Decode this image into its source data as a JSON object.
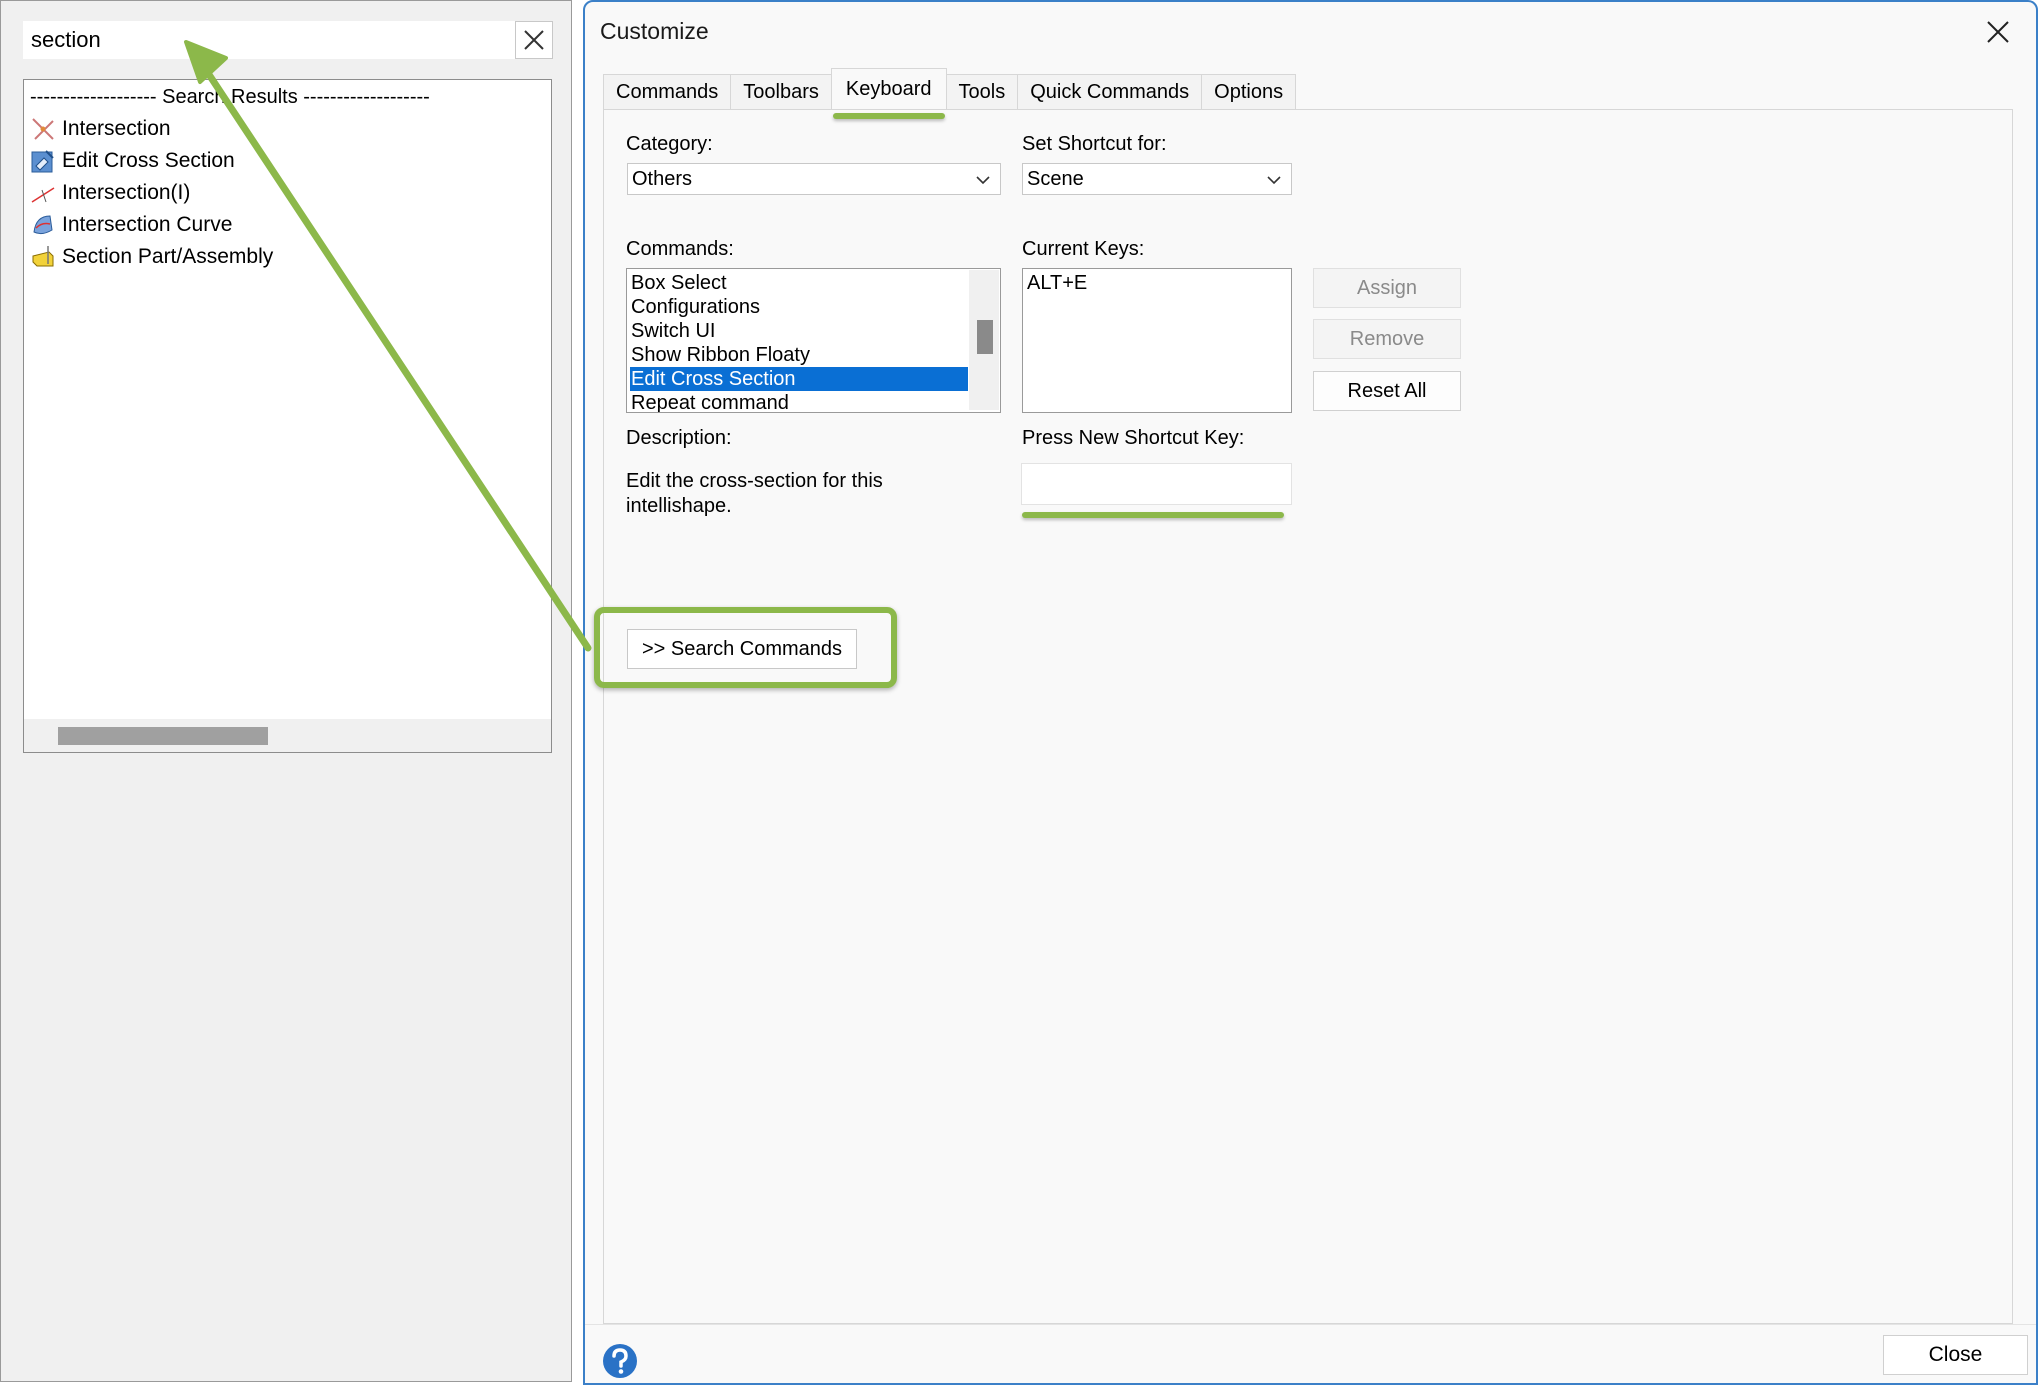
{
  "search_panel": {
    "query": "section",
    "results_header": "------------------- Search Results -------------------",
    "results": [
      {
        "label": "Intersection",
        "icon": "intersection-icon"
      },
      {
        "label": "Edit Cross Section",
        "icon": "edit-cross-section-icon"
      },
      {
        "label": "Intersection(I)",
        "icon": "intersection-line-icon"
      },
      {
        "label": "Intersection Curve",
        "icon": "intersection-curve-icon"
      },
      {
        "label": "Section Part/Assembly",
        "icon": "section-part-icon"
      }
    ]
  },
  "dialog": {
    "title": "Customize",
    "tabs": [
      "Commands",
      "Toolbars",
      "Keyboard",
      "Tools",
      "Quick Commands",
      "Options"
    ],
    "active_tab": "Keyboard",
    "category_label": "Category:",
    "category_value": "Others",
    "set_shortcut_label": "Set Shortcut for:",
    "set_shortcut_value": "Scene",
    "commands_label": "Commands:",
    "commands": [
      "Box Select",
      "Configurations",
      "Switch UI",
      "Show Ribbon Floaty",
      "Edit Cross Section",
      "Repeat command"
    ],
    "selected_command": "Edit Cross Section",
    "current_keys_label": "Current Keys:",
    "current_keys": [
      "ALT+E"
    ],
    "assign_label": "Assign",
    "remove_label": "Remove",
    "reset_all_label": "Reset All",
    "description_label": "Description:",
    "description_text": "Edit the cross-section for this intellishape.",
    "press_new_shortcut_label": "Press New Shortcut Key:",
    "search_commands_label": ">> Search Commands",
    "close_label": "Close"
  },
  "colors": {
    "annotation_green": "#8cb84a",
    "selection_blue": "#0a6fd4",
    "dialog_border": "#3b80c8",
    "help_blue": "#2a72c6"
  }
}
